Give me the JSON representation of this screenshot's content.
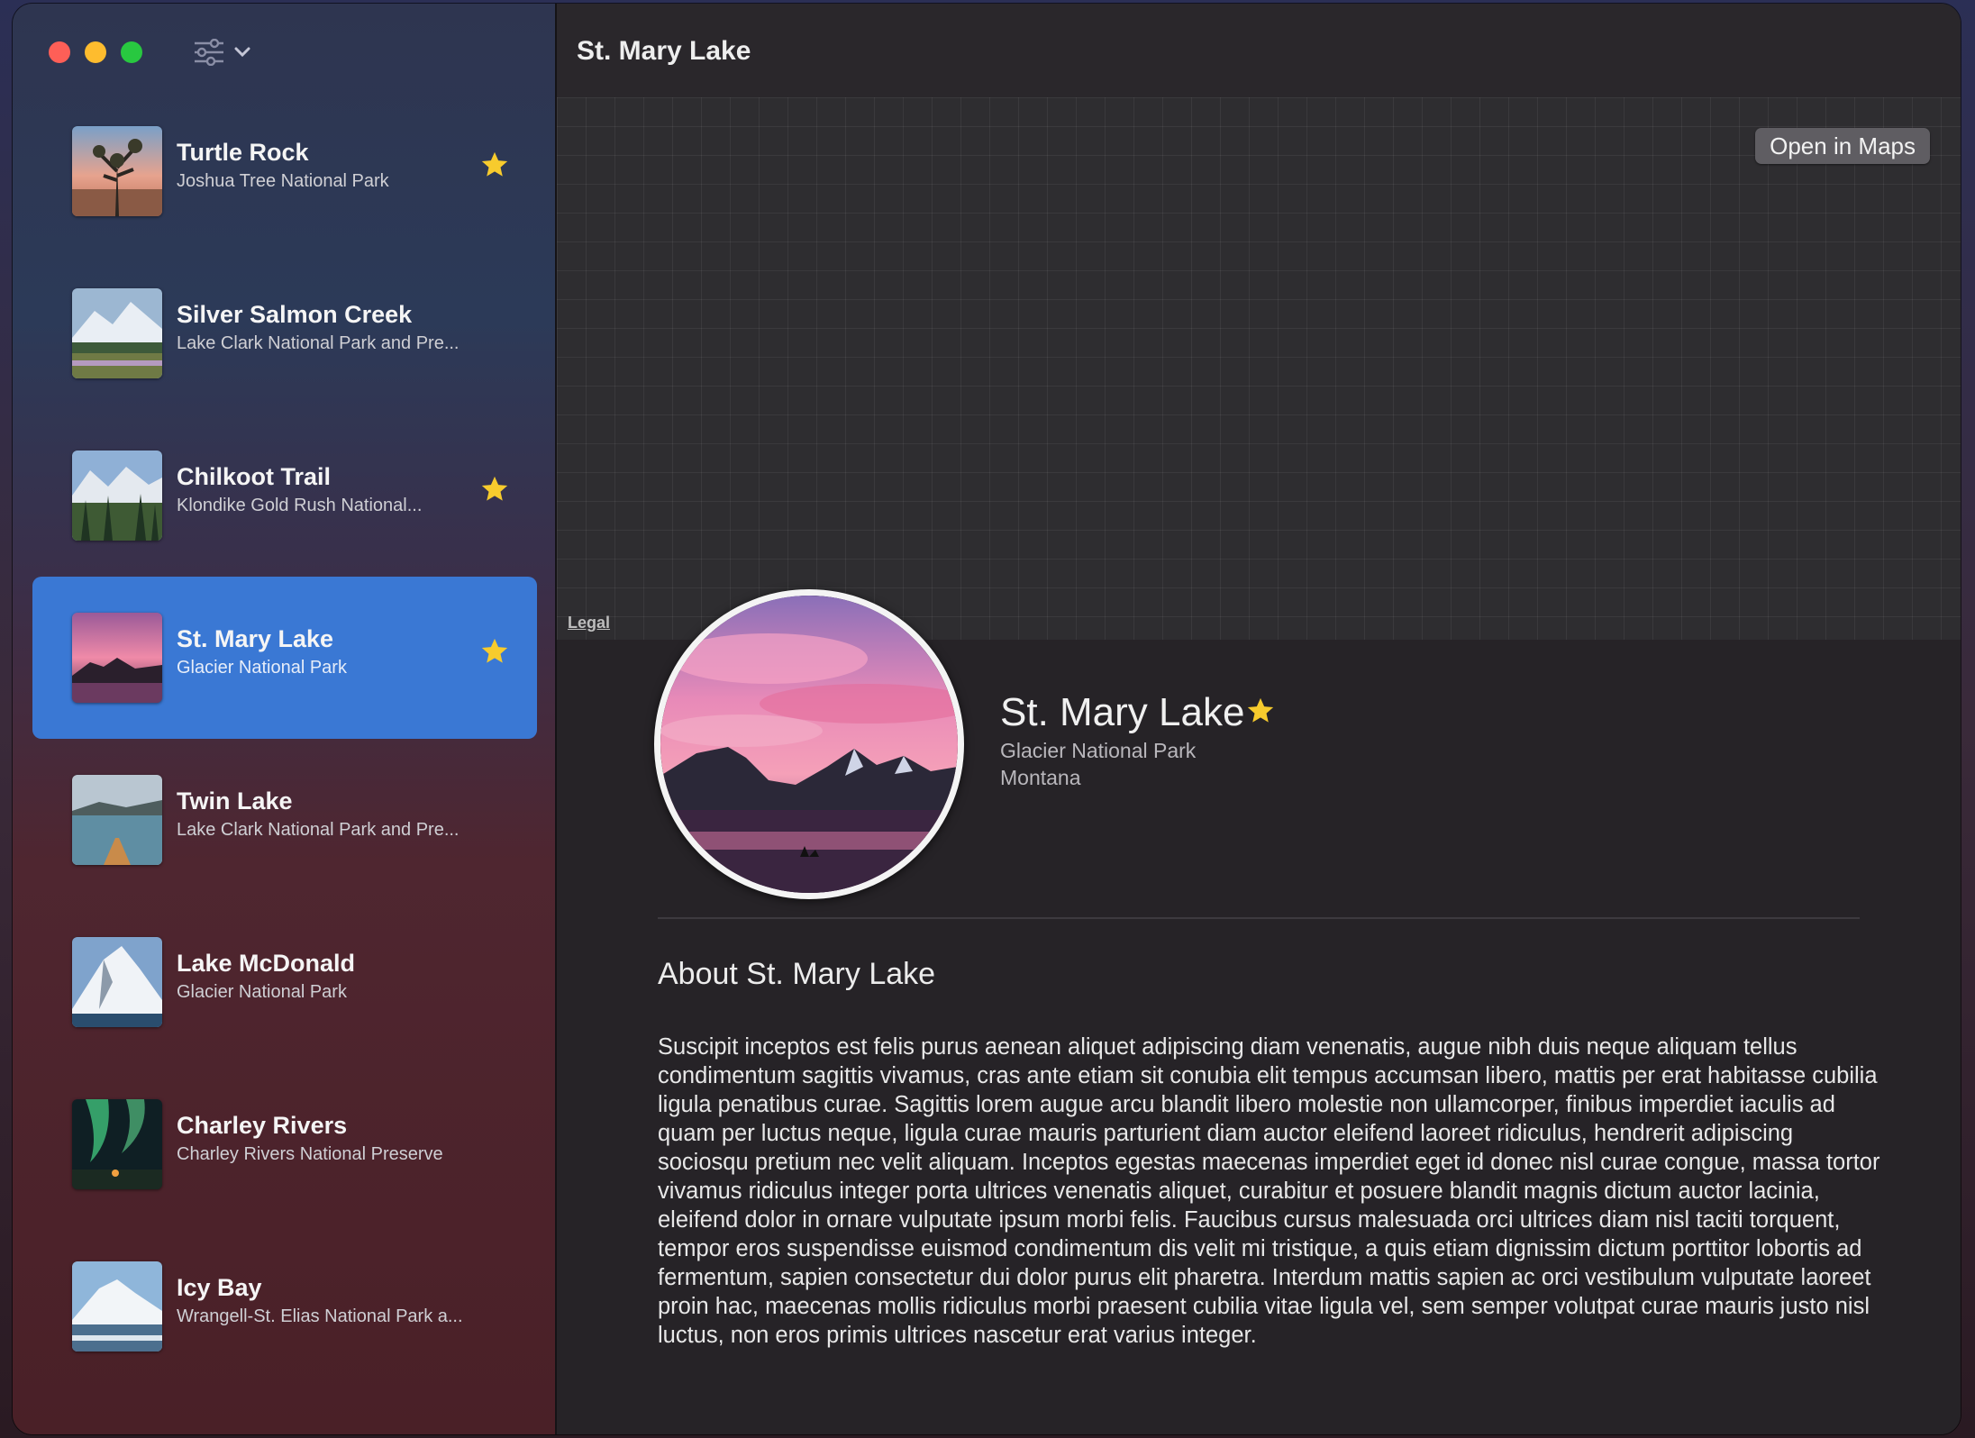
{
  "window": {
    "title": "St. Mary Lake"
  },
  "sidebar": {
    "filter_icon": "slider-icon",
    "items": [
      {
        "name": "Turtle Rock",
        "park": "Joshua Tree National Park",
        "favorite": true,
        "selected": false
      },
      {
        "name": "Silver Salmon Creek",
        "park": "Lake Clark National Park and Pre...",
        "favorite": false,
        "selected": false
      },
      {
        "name": "Chilkoot Trail",
        "park": "Klondike Gold Rush National...",
        "favorite": true,
        "selected": false
      },
      {
        "name": "St. Mary Lake",
        "park": "Glacier National Park",
        "favorite": true,
        "selected": true
      },
      {
        "name": "Twin Lake",
        "park": "Lake Clark National Park and Pre...",
        "favorite": false,
        "selected": false
      },
      {
        "name": "Lake McDonald",
        "park": "Glacier National Park",
        "favorite": false,
        "selected": false
      },
      {
        "name": "Charley Rivers",
        "park": "Charley Rivers National Preserve",
        "favorite": false,
        "selected": false
      },
      {
        "name": "Icy Bay",
        "park": "Wrangell-St. Elias National Park a...",
        "favorite": false,
        "selected": false
      }
    ]
  },
  "map": {
    "open_maps_label": "Open in Maps",
    "legal_label": "Legal"
  },
  "detail": {
    "title": "St. Mary Lake",
    "favorite": true,
    "park": "Glacier National Park",
    "state": "Montana",
    "about_title": "About St. Mary Lake",
    "description": "Suscipit inceptos est felis purus aenean aliquet adipiscing diam venenatis, augue nibh duis neque aliquam tellus condimentum sagittis vivamus, cras ante etiam sit conubia elit tempus accumsan libero, mattis per erat habitasse cubilia ligula penatibus curae. Sagittis lorem augue arcu blandit libero molestie non ullamcorper, finibus imperdiet iaculis ad quam per luctus neque, ligula curae mauris parturient diam auctor eleifend laoreet ridiculus, hendrerit adipiscing sociosqu pretium nec velit aliquam. Inceptos egestas maecenas imperdiet eget id donec nisl curae congue, massa tortor vivamus ridiculus integer porta ultrices venenatis aliquet, curabitur et posuere blandit magnis dictum auctor lacinia, eleifend dolor in ornare vulputate ipsum morbi felis. Faucibus cursus malesuada orci ultrices diam nisl taciti torquent, tempor eros suspendisse euismod condimentum dis velit mi tristique, a quis etiam dignissim dictum porttitor lobortis ad fermentum, sapien consectetur dui dolor purus elit pharetra. Interdum mattis sapien ac orci vestibulum vulputate laoreet proin hac, maecenas mollis ridiculus morbi praesent cubilia vitae ligula vel, sem semper volutpat curae mauris justo nisl luctus, non eros primis ultrices nascetur erat varius integer."
  },
  "colors": {
    "accent": "#3a78d4",
    "star": "#f7cb2d",
    "close": "#fe5f57",
    "minimize": "#febc2e",
    "maximize": "#28c840"
  }
}
